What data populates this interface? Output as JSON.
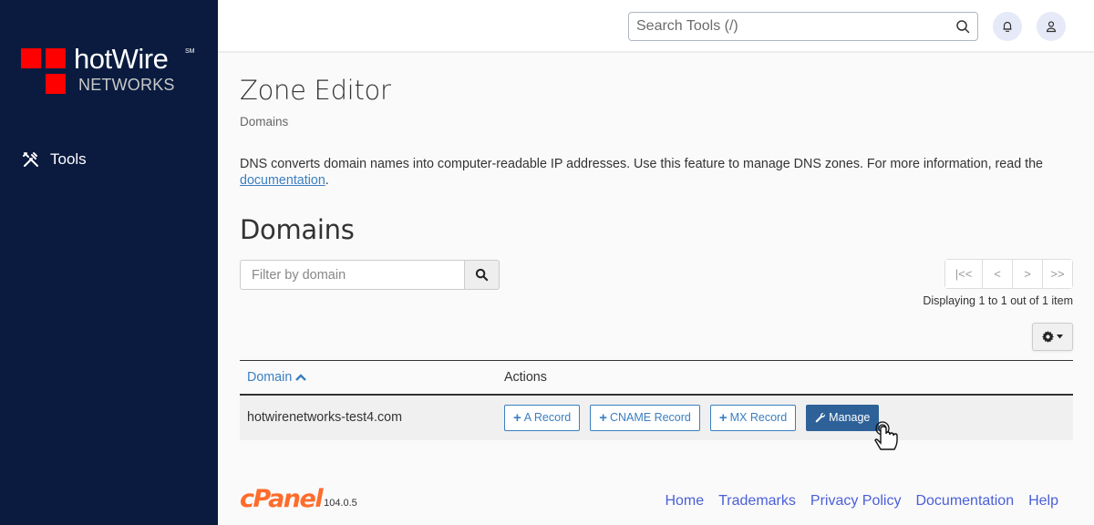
{
  "sidebar": {
    "logo": {
      "brand": "hotWire",
      "mark": "SM",
      "sub": "NETWORKS",
      "square_color": "#ff0000"
    },
    "items": [
      {
        "label": "Tools",
        "icon": "tools-icon"
      }
    ]
  },
  "header": {
    "search_placeholder": "Search Tools (/)",
    "notifications_icon": "bell-icon",
    "user_icon": "user-icon"
  },
  "main": {
    "title": "Zone Editor",
    "breadcrumb": "Domains",
    "description": "DNS converts domain names into computer-readable IP addresses. Use this feature to manage DNS zones. For more information, read the ",
    "description_link": "documentation",
    "description_end": ".",
    "section_title": "Domains",
    "filter_placeholder": "Filter by domain",
    "pager": {
      "first": "|<<",
      "prev": "<",
      "next": ">",
      "last": ">>"
    },
    "pager_info": "Displaying 1 to 1 out of 1 item",
    "table": {
      "columns": [
        "Domain",
        "Actions"
      ],
      "sort": "ascending",
      "rows": [
        {
          "domain": "hotwirenetworks-test4.com",
          "actions": [
            "A Record",
            "CNAME Record",
            "MX Record",
            "Manage"
          ]
        }
      ]
    }
  },
  "footer": {
    "brand": "cPanel",
    "version": "104.0.5",
    "links": [
      "Home",
      "Trademarks",
      "Privacy Policy",
      "Documentation",
      "Help"
    ]
  },
  "colors": {
    "sidebar_bg": "#0a1b3f",
    "accent": "#3a7fc1",
    "primary_button": "#2d6198",
    "cpanel_orange": "#ff6c2c",
    "footer_link": "#4a5fd8"
  }
}
